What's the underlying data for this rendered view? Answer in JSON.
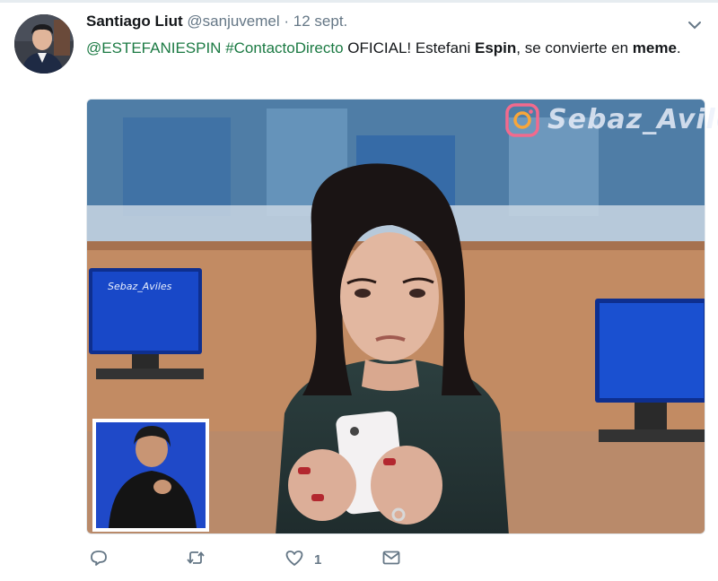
{
  "tweet": {
    "author_name": "Santiago Liut",
    "author_handle": "@sanjuvemel",
    "separator": "·",
    "date": "12 sept.",
    "text": {
      "mention": "@ESTEFANIESPIN",
      "hashtag": "#ContactoDirecto",
      "part1": " OFICIAL! Estefani ",
      "bold1": "Espin",
      "part2": ", se convierte en ",
      "bold2": "meme",
      "part3": "."
    },
    "media": {
      "watermark_large": "Sebaz_Aviles",
      "watermark_small": "Sebaz_Aviles"
    },
    "actions": {
      "like_count": "1"
    }
  },
  "icons": {
    "menu": "chevron-down-icon",
    "reply": "reply-icon",
    "retweet": "retweet-icon",
    "like": "heart-icon",
    "message": "envelope-icon",
    "watermark": "instagram-icon"
  },
  "colors": {
    "link": "#1b7a43",
    "muted": "#657786",
    "text": "#14171a"
  }
}
